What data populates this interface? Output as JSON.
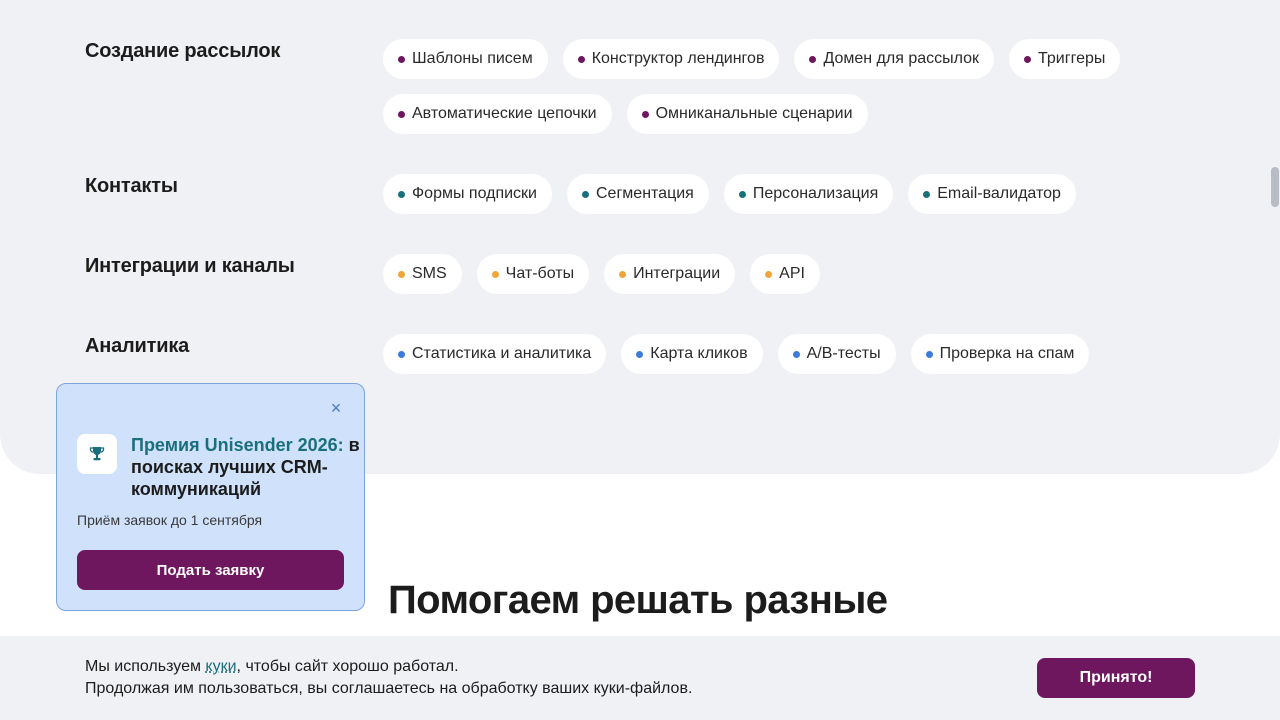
{
  "colors": {
    "purple": "#6e175f",
    "teal": "#1a6f7c",
    "orange": "#f0a53a",
    "blue": "#3a7bdc",
    "panel_bg": "#f0f1f5",
    "promo_bg": "#cfe1fb"
  },
  "features": {
    "sections": [
      {
        "title": "Создание рассылок",
        "dot_color": "#6e175f",
        "items": [
          "Шаблоны писем",
          "Конструктор лендингов",
          "Домен для рассылок",
          "Триггеры",
          "Автоматические цепочки",
          "Омниканальные сценарии"
        ]
      },
      {
        "title": "Контакты",
        "dot_color": "#1a6f7c",
        "items": [
          "Формы подписки",
          "Сегментация",
          "Персонализация",
          "Email-валидатор"
        ]
      },
      {
        "title": "Интеграции и каналы",
        "dot_color": "#f0a53a",
        "items": [
          "SMS",
          "Чат-боты",
          "Интеграции",
          "API"
        ]
      },
      {
        "title": "Аналитика",
        "dot_color": "#3a7bdc",
        "items": [
          "Статистика и аналитика",
          "Карта кликов",
          "A/B-тесты",
          "Проверка на спам"
        ]
      }
    ]
  },
  "heading": "Помогаем решать разные",
  "promo": {
    "close_icon": "×",
    "icon": "trophy-icon",
    "title_accent": "Премия Unisender 2026:",
    "title_rest": "в поисках лучших CRM-коммуникаций",
    "note": "Приём заявок до 1 сентября",
    "button_label": "Подать заявку"
  },
  "cookie": {
    "text_before_link": "Мы используем ",
    "link_label": "куки",
    "text_after_link": ", чтобы сайт хорошо работал.",
    "line2": "Продолжая им пользоваться, вы соглашаетесь на обработку ваших куки-файлов.",
    "accept_label": "Принято!"
  }
}
